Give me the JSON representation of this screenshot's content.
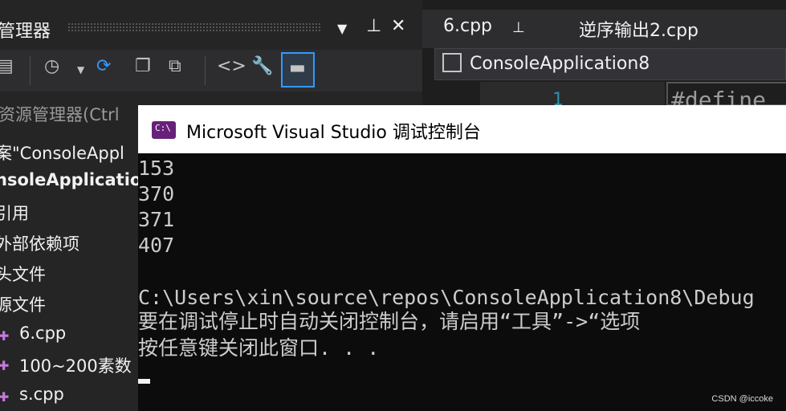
{
  "solution_explorer": {
    "title": "管理器",
    "pin_icon_glyph": "📌",
    "search_placeholder": "资源管理器(Ctrl",
    "tree": [
      {
        "label": "案\"ConsoleAppl",
        "bold": false
      },
      {
        "label": "nsoleApplicatio",
        "bold": true
      },
      {
        "label": "引用",
        "bold": false
      },
      {
        "label": "外部依赖项",
        "bold": false
      },
      {
        "label": "头文件",
        "bold": false
      },
      {
        "label": "源文件",
        "bold": false
      },
      {
        "label": "6.cpp",
        "bold": false
      },
      {
        "label": "100~200素数",
        "bold": false
      },
      {
        "label": "s.cpp",
        "bold": false
      }
    ]
  },
  "editor": {
    "tabs": [
      {
        "label": "6.cpp",
        "pinned": true
      },
      {
        "label": "逆序输出2.cpp",
        "pinned": false
      }
    ],
    "nav_project": "ConsoleApplication8",
    "line_number": "1",
    "code_line": "#define"
  },
  "console": {
    "title": "Microsoft Visual Studio 调试控制台",
    "icon_text": "C:\\",
    "output": [
      "153",
      "370",
      "371",
      "407",
      "",
      "C:\\Users\\xin\\source\\repos\\ConsoleApplication8\\Debug",
      "要在调试停止时自动关闭控制台，请启用“工具”->“选项",
      "按任意键关闭此窗口. . ."
    ]
  },
  "watermark": "CSDN @iccoke",
  "colors": {
    "accent": "#3399ff",
    "console_bg": "#0c0c0c",
    "panel_bg": "#252526"
  }
}
